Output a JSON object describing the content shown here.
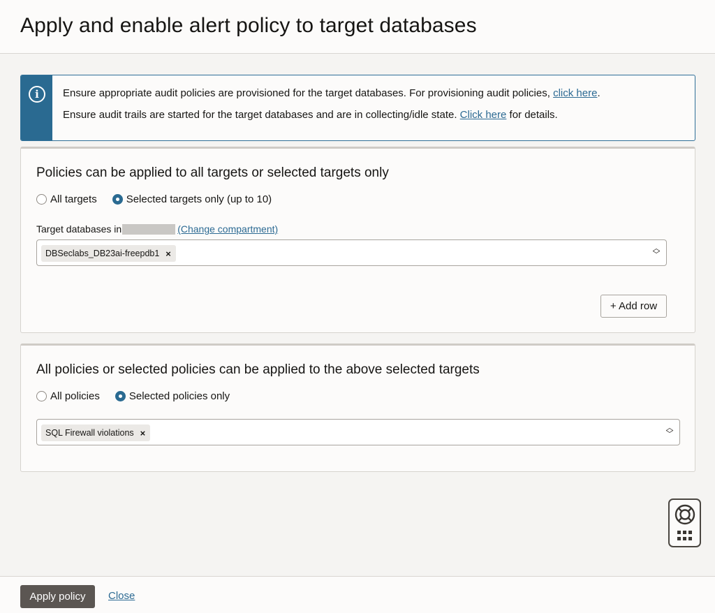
{
  "header": {
    "title": "Apply and enable alert policy to target databases"
  },
  "info_banner": {
    "line1_text": "Ensure appropriate audit policies are provisioned for the target databases. For provisioning audit policies, ",
    "line1_link": "click here",
    "line1_suffix": ".",
    "line2_text": "Ensure audit trails are started for the target databases and are in collecting/idle state. ",
    "line2_link": "Click here",
    "line2_suffix": " for details."
  },
  "targets_panel": {
    "title": "Policies can be applied to all targets or selected targets only",
    "radio_all_label": "All targets",
    "radio_selected_label": "Selected targets only (up to 10)",
    "selected_option": "Selected targets only (up to 10)",
    "field_label": "Target databases in",
    "change_compartment_link": "(Change compartment)",
    "selected_chip": "DBSeclabs_DB23ai-freepdb1",
    "chip_remove": "×",
    "add_row_label": "+ Add row"
  },
  "policies_panel": {
    "title": "All policies or selected policies can be applied to the above selected targets",
    "radio_all_label": "All policies",
    "radio_selected_label": "Selected policies only",
    "selected_option": "Selected policies only",
    "selected_chip": "SQL Firewall violations",
    "chip_remove": "×"
  },
  "footer": {
    "apply_label": "Apply policy",
    "close_label": "Close"
  },
  "colors": {
    "accent": "#2a6a91",
    "primary_button": "#5b5652",
    "link": "#2c6a93"
  }
}
